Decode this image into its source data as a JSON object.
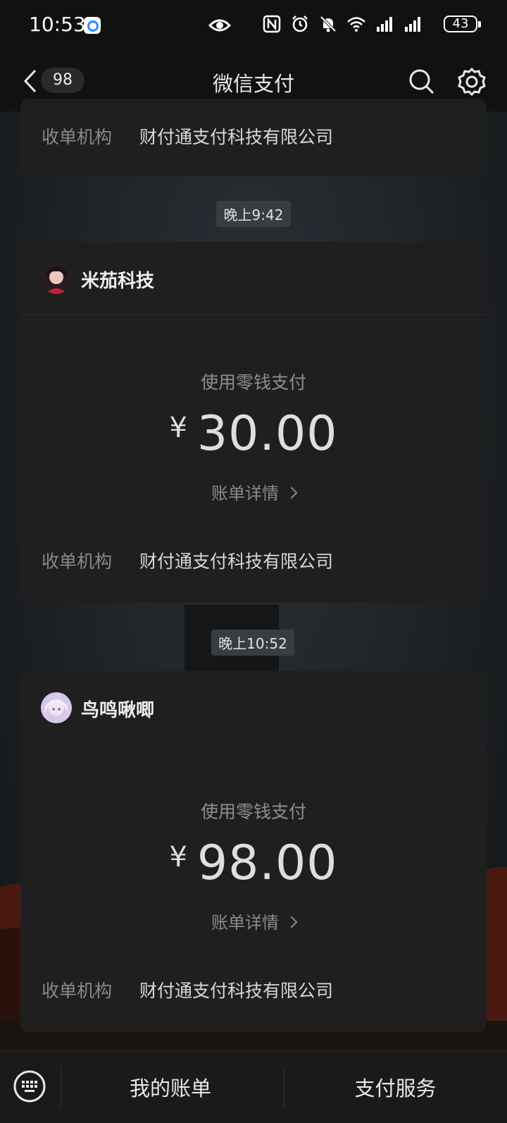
{
  "status": {
    "time": "10:53",
    "battery": "43"
  },
  "nav": {
    "back_count": "98",
    "title": "微信支付"
  },
  "top_card": {
    "label": "收单机构",
    "value": "财付通支付科技有限公司"
  },
  "messages": [
    {
      "time": "晚上9:42",
      "merchant": "米茄科技",
      "pay_method": "使用零钱支付",
      "currency": "¥",
      "amount": "30.00",
      "detail": "账单详情",
      "label": "收单机构",
      "value": "财付通支付科技有限公司"
    },
    {
      "time": "晚上10:52",
      "merchant": "鸟鸣啾唧",
      "pay_method": "使用零钱支付",
      "currency": "¥",
      "amount": "98.00",
      "detail": "账单详情",
      "label": "收单机构",
      "value": "财付通支付科技有限公司"
    }
  ],
  "bottom": {
    "menu1": "我的账单",
    "menu2": "支付服务"
  }
}
